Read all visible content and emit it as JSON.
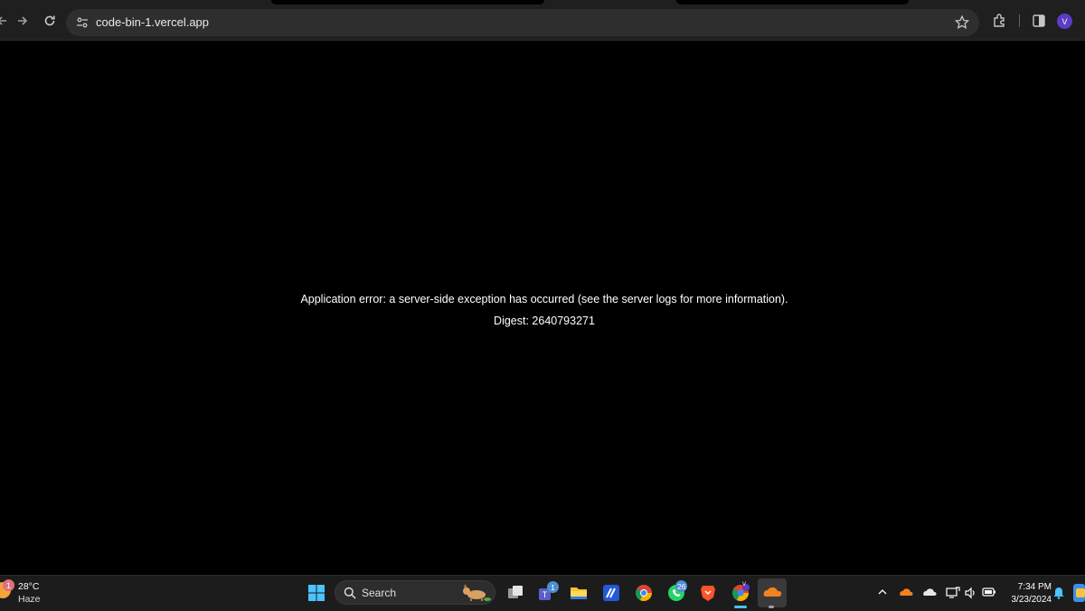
{
  "browser": {
    "url": "code-bin-1.vercel.app",
    "avatar_letter": "V"
  },
  "page": {
    "error_message": "Application error: a server-side exception has occurred (see the server logs for more information).",
    "digest": "Digest: 2640793271"
  },
  "taskbar": {
    "weather": {
      "temp": "28°C",
      "condition": "Haze",
      "badge": "1"
    },
    "search_label": "Search",
    "teams_badge": "1",
    "whatsapp_badge": "26",
    "chrome_profile_letter": "V",
    "clock": {
      "time": "7:34 PM",
      "date": "3/23/2024"
    }
  },
  "colors": {
    "page_background": "#000000",
    "chrome_background": "#1f1f1f",
    "omnibox": "#2e2e2e",
    "taskbar": "#1c1c1c",
    "avatar": "#5b3cc4"
  }
}
